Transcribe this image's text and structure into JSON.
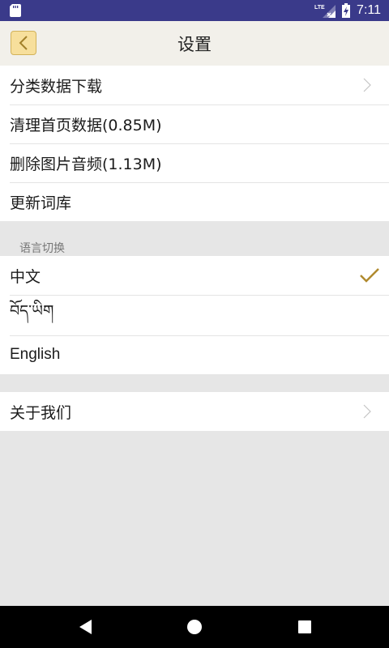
{
  "status_bar": {
    "time": "7:11",
    "icons": [
      "sd-card-icon",
      "lte-signal-icon",
      "battery-charging-icon"
    ]
  },
  "toolbar": {
    "title": "设置",
    "back_icon": "chevron-left-icon"
  },
  "data_group": {
    "items": [
      {
        "label": "分类数据下载",
        "icon": "chevron-right-icon"
      },
      {
        "label": "清理首页数据(0.85M)"
      },
      {
        "label": "删除图片音频(1.13M)"
      },
      {
        "label": "更新词库"
      }
    ]
  },
  "language_section": {
    "header": "语言切换",
    "items": [
      {
        "label": "中文",
        "selected": true,
        "icon": "checkmark-icon"
      },
      {
        "label": "བོད་ཡིག"
      },
      {
        "label": "English"
      }
    ]
  },
  "about_group": {
    "items": [
      {
        "label": "关于我们",
        "icon": "chevron-right-icon"
      }
    ]
  },
  "nav_bar": {
    "buttons": [
      "back-triangle-icon",
      "home-circle-icon",
      "recents-square-icon"
    ]
  },
  "colors": {
    "status_bar": "#3a3a8a",
    "toolbar": "#f2f0ea",
    "accent": "#b08a2e",
    "background": "#e6e6e6"
  }
}
